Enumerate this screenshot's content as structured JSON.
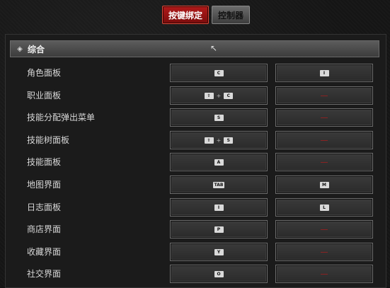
{
  "tabs": [
    {
      "label": "按键绑定",
      "active": true
    },
    {
      "label": "控制器",
      "active": false
    }
  ],
  "section": {
    "title": "综合",
    "icon": "diamond-icon"
  },
  "rows": [
    {
      "label": "角色面板",
      "primary": [
        "C"
      ],
      "secondary": [
        "I"
      ]
    },
    {
      "label": "职业面板",
      "primary": [
        "⇧",
        "C"
      ],
      "secondary": []
    },
    {
      "label": "技能分配弹出菜单",
      "primary": [
        "S"
      ],
      "secondary": []
    },
    {
      "label": "技能树面板",
      "primary": [
        "⇧",
        "S"
      ],
      "secondary": []
    },
    {
      "label": "技能面板",
      "primary": [
        "A"
      ],
      "secondary": []
    },
    {
      "label": "地图界面",
      "primary": [
        "TAB"
      ],
      "secondary": [
        "M"
      ]
    },
    {
      "label": "日志面板",
      "primary": [
        "I"
      ],
      "secondary": [
        "L"
      ]
    },
    {
      "label": "商店界面",
      "primary": [
        "P"
      ],
      "secondary": []
    },
    {
      "label": "收藏界面",
      "primary": [
        "Y"
      ],
      "secondary": []
    },
    {
      "label": "社交界面",
      "primary": [
        "O"
      ],
      "secondary": []
    }
  ],
  "plus_symbol": "+",
  "colors": {
    "accent": "#b21a1a",
    "unbound_dash": "#8a2222"
  }
}
